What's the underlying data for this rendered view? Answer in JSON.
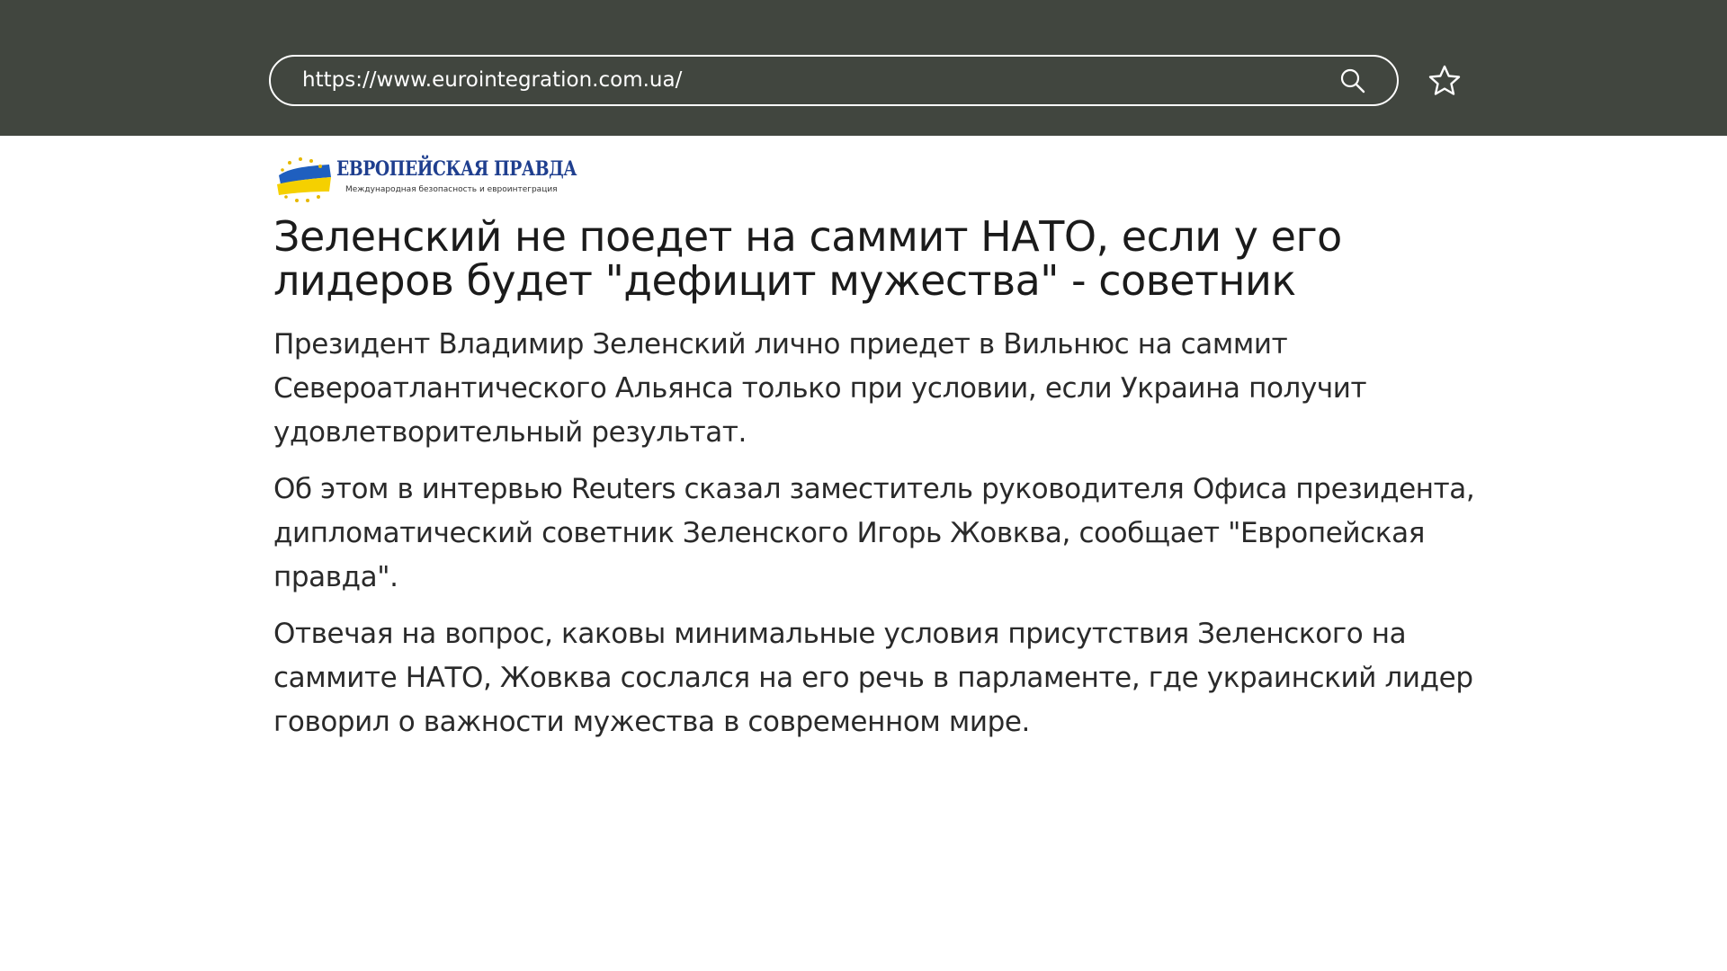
{
  "browser": {
    "url": "https://www.eurointegration.com.ua/",
    "search_icon": "search-icon",
    "bookmark_icon": "star-icon"
  },
  "logo": {
    "title": "ЕВРОПЕЙСКАЯ ПРАВДА",
    "subtitle": "Международная безопасность и евроинтеграция",
    "colors": {
      "blue": "#1f5fbf",
      "yellow": "#f5d000",
      "navy": "#1f3f8f"
    }
  },
  "article": {
    "headline": "Зеленский не поедет на саммит НАТО, если у его лидеров будет \"дефицит мужества\" - советник",
    "paragraphs": [
      "Президент Владимир Зеленский лично приедет в Вильнюс на саммит Североатлантического Альянса только при условии, если Украина получит удовлетворительный результат.",
      "Об этом в интервью Reuters сказал заместитель руководителя Офиса президента, дипломатический советник Зеленского Игорь Жовква, сообщает \"Европейская правда\".",
      "Отвечая на вопрос, каковы минимальные условия присутствия Зеленского на саммите НАТО, Жовква сослался на его речь в парламенте, где украинский лидер говорил о важности мужества в современном мире."
    ]
  },
  "colors": {
    "topbar": "#41463f",
    "text": "#1b1b1b"
  }
}
